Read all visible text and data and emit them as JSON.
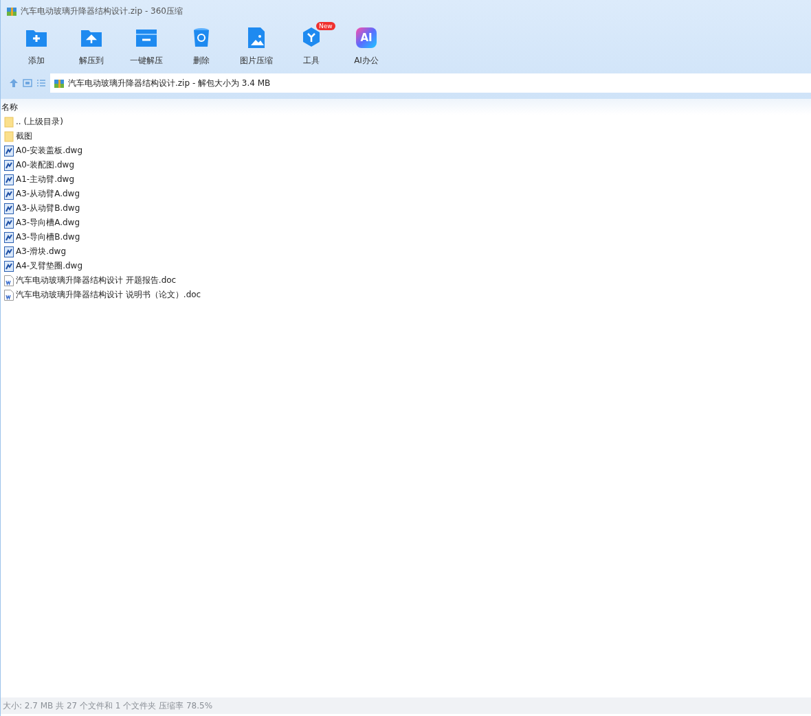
{
  "window": {
    "title": "汽车电动玻璃升降器结构设计.zip - 360压缩"
  },
  "toolbar": [
    {
      "kind": "add",
      "label": "添加"
    },
    {
      "kind": "extract",
      "label": "解压到"
    },
    {
      "kind": "oneclick",
      "label": "一键解压"
    },
    {
      "kind": "delete",
      "label": "删除"
    },
    {
      "kind": "image",
      "label": "图片压缩"
    },
    {
      "kind": "tools",
      "label": "工具",
      "badge": "New"
    },
    {
      "kind": "ai",
      "label": "AI办公",
      "glyph": "AI"
    }
  ],
  "address": {
    "path": "汽车电动玻璃升降器结构设计.zip - 解包大小为 3.4 MB"
  },
  "table": {
    "columns": [
      "名称"
    ],
    "rows": [
      {
        "kind": "folder",
        "name": ".. (上级目录)"
      },
      {
        "kind": "folder",
        "name": "截图"
      },
      {
        "kind": "dwg",
        "name": "A0-安装盖板.dwg"
      },
      {
        "kind": "dwg",
        "name": "A0-装配图.dwg"
      },
      {
        "kind": "dwg",
        "name": "A1-主动臂.dwg"
      },
      {
        "kind": "dwg",
        "name": "A3-从动臂A.dwg"
      },
      {
        "kind": "dwg",
        "name": "A3-从动臂B.dwg"
      },
      {
        "kind": "dwg",
        "name": "A3-导向槽A.dwg"
      },
      {
        "kind": "dwg",
        "name": "A3-导向槽B.dwg"
      },
      {
        "kind": "dwg",
        "name": "A3-滑块.dwg"
      },
      {
        "kind": "dwg",
        "name": "A4-叉臂垫圈.dwg"
      },
      {
        "kind": "doc",
        "name": "汽车电动玻璃升降器结构设计 开题报告.doc"
      },
      {
        "kind": "doc",
        "name": "汽车电动玻璃升降器结构设计 说明书（论文）.doc"
      }
    ]
  },
  "status_bar": "大小: 2.7 MB 共 27 个文件和 1 个文件夹 压缩率 78.5%"
}
